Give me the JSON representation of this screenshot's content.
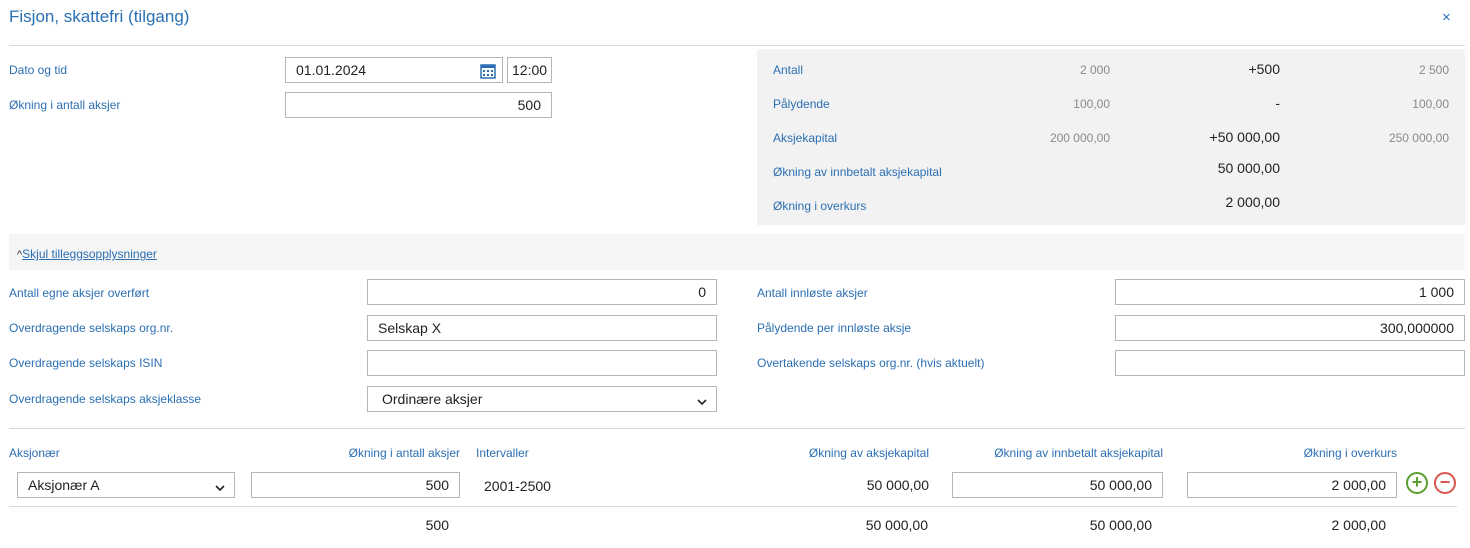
{
  "header": {
    "title": "Fisjon, skattefri (tilgang)",
    "close_icon": "×"
  },
  "form": {
    "date_label": "Dato og tid",
    "date_value": "01.01.2024",
    "time_value": "12:00",
    "increase_label": "Økning i antall aksjer",
    "increase_value": "500"
  },
  "summary": {
    "rows": [
      {
        "label": "Antall",
        "before": "2 000",
        "delta": "+500",
        "after": "2 500"
      },
      {
        "label": "Pålydende",
        "before": "100,00",
        "delta": "-",
        "after": "100,00"
      },
      {
        "label": "Aksjekapital",
        "before": "200 000,00",
        "delta": "+50 000,00",
        "after": "250 000,00"
      },
      {
        "label": "Økning av innbetalt aksjekapital",
        "before": "",
        "delta": "50 000,00",
        "after": ""
      },
      {
        "label": "Økning i overkurs",
        "before": "",
        "delta": "2 000,00",
        "after": ""
      }
    ]
  },
  "extra": {
    "toggle_label": "Skjul tilleggsopplysninger",
    "toggle_icon": "^",
    "left": [
      {
        "label": "Antall egne aksjer overført",
        "value": "0",
        "align": "right"
      },
      {
        "label": "Overdragende selskaps org.nr.",
        "value": "Selskap X",
        "align": "left"
      },
      {
        "label": "Overdragende selskaps ISIN",
        "value": "",
        "align": "left"
      }
    ],
    "share_class_label": "Overdragende selskaps aksjeklasse",
    "share_class_value": "Ordinære aksjer",
    "right": [
      {
        "label": "Antall innløste aksjer",
        "value": "1 000"
      },
      {
        "label": "Pålydende per innløste aksje",
        "value": "300,000000"
      },
      {
        "label": "Overtakende selskaps org.nr. (hvis aktuelt)",
        "value": ""
      }
    ]
  },
  "table": {
    "headers": {
      "shareholder": "Aksjonær",
      "increase": "Økning i antall aksjer",
      "intervals": "Intervaller",
      "capital": "Økning av aksjekapital",
      "paid_in": "Økning av innbetalt aksjekapital",
      "premium": "Økning i overkurs"
    },
    "row": {
      "shareholder": "Aksjonær A",
      "increase": "500",
      "intervals": "2001-2500",
      "capital": "50 000,00",
      "paid_in": "50 000,00",
      "premium": "2 000,00"
    },
    "totals": {
      "increase": "500",
      "capital": "50 000,00",
      "paid_in": "50 000,00",
      "premium": "2 000,00"
    },
    "add_icon": "+",
    "remove_icon": "−"
  },
  "colors": {
    "accent": "#2b6fb3",
    "add": "#5a9e2f",
    "remove": "#d9534f"
  }
}
